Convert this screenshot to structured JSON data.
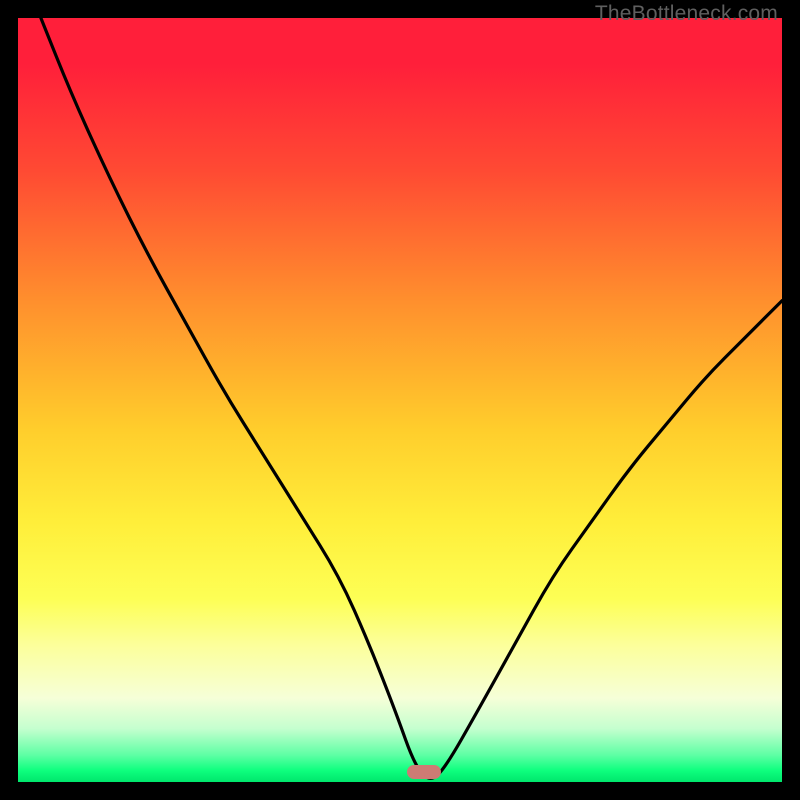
{
  "attribution": "TheBottleneck.com",
  "colors": {
    "curve_stroke": "#000000",
    "marker_fill": "#cd7b74",
    "frame": "#000000"
  },
  "chart_data": {
    "type": "line",
    "title": "",
    "xlabel": "",
    "ylabel": "",
    "xlim": [
      0,
      100
    ],
    "ylim": [
      0,
      100
    ],
    "series": [
      {
        "name": "bottleneck-curve",
        "x": [
          3,
          7,
          12,
          17,
          22,
          27,
          32,
          37,
          42,
          46,
          49.5,
          52,
          54,
          56,
          60,
          65,
          70,
          75,
          80,
          85,
          90,
          95,
          100
        ],
        "y": [
          100,
          90,
          79,
          69,
          60,
          51,
          43,
          35,
          27,
          18,
          9,
          2,
          0,
          2,
          9,
          18,
          27,
          34,
          41,
          47,
          53,
          58,
          63
        ]
      }
    ],
    "marker": {
      "x_percent": 53.2,
      "y_percent": 1.0
    },
    "background_gradient": [
      {
        "stop": 0.0,
        "color": "#ff1f3a"
      },
      {
        "stop": 0.37,
        "color": "#ff8f2d"
      },
      {
        "stop": 0.66,
        "color": "#ffee3a"
      },
      {
        "stop": 0.89,
        "color": "#f6ffd8"
      },
      {
        "stop": 1.0,
        "color": "#00e66c"
      }
    ]
  }
}
